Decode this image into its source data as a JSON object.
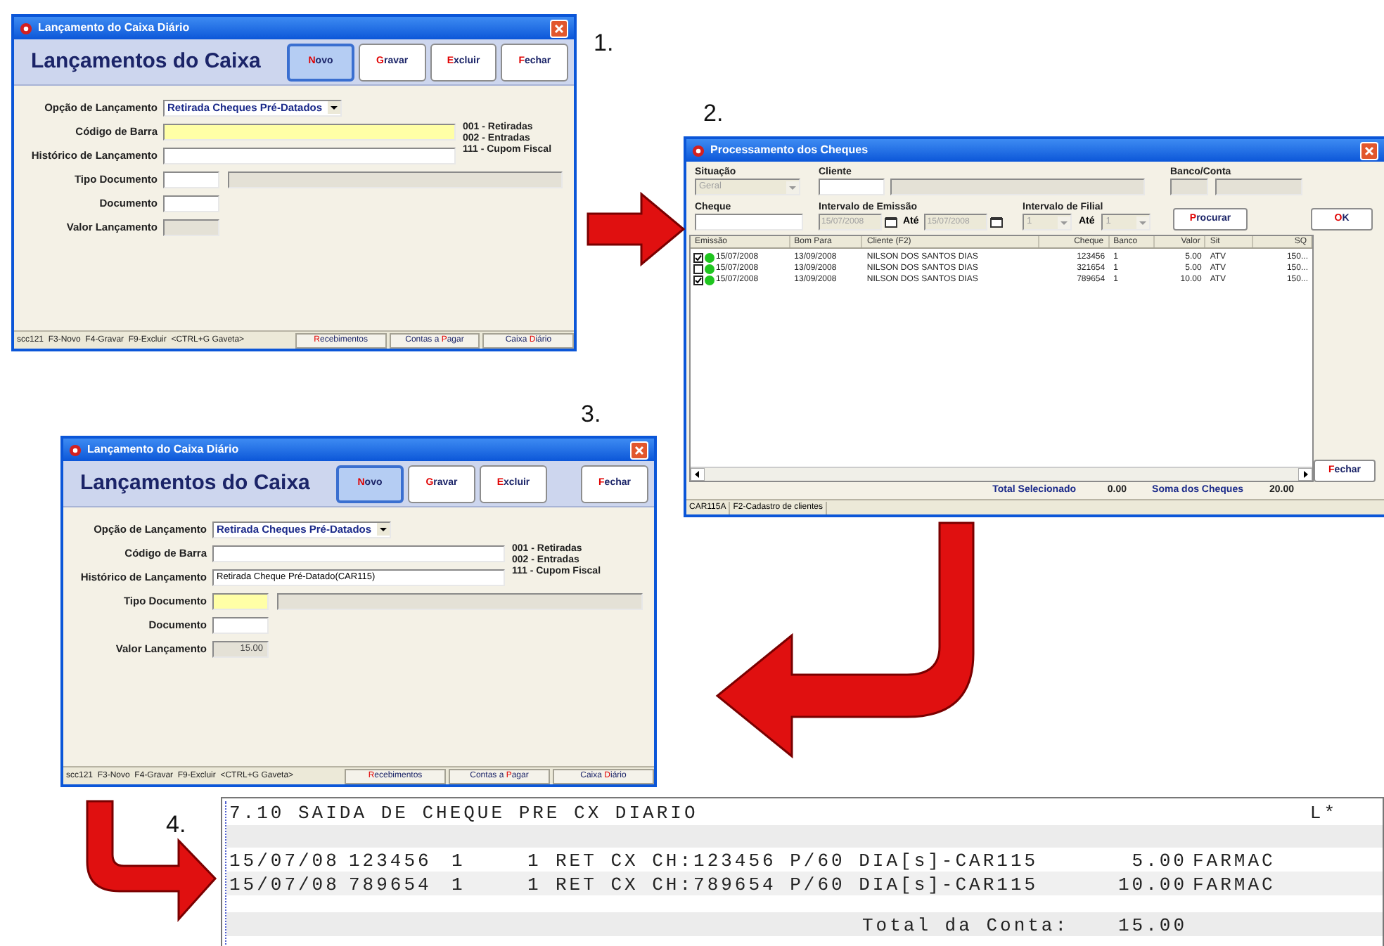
{
  "steps": [
    {
      "kind": "entry_form",
      "step": "1.",
      "title": "Lançamento do Caixa Diário",
      "heading": "Lançamentos do Caixa",
      "buttons": [
        {
          "hotkey": "N",
          "after": "ovo",
          "selected": true
        },
        {
          "hotkey": "G",
          "after": "ravar",
          "selected": false
        },
        {
          "hotkey": "E",
          "after": "xcluir",
          "selected": false
        },
        {
          "hotkey": "F",
          "after": "echar",
          "selected": false
        }
      ],
      "fields": [
        {
          "kind": "combo",
          "label": "Opção de Lançamento",
          "value": "Retirada Cheques Pré-Datados",
          "focused": false,
          "disabled": false
        },
        {
          "kind": "wide",
          "label": "Código de Barra",
          "focused": true,
          "disabled": false
        },
        {
          "kind": "wide",
          "label": "Histórico de Lançamento",
          "focused": false,
          "disabled": false
        },
        {
          "kind": "pair",
          "label": "Tipo Documento",
          "focused": false,
          "disabled": false
        },
        {
          "kind": "short",
          "label": "Documento",
          "focused": false,
          "disabled": false
        },
        {
          "kind": "short",
          "label": "Valor Lançamento",
          "focused": false,
          "disabled": true
        }
      ],
      "codes": [
        "001 - Retiradas",
        "002 - Entradas",
        "111 - Cupom Fiscal"
      ],
      "status": {
        "text": "scc121  F3-Novo  F4-Gravar  F9-Excluir  <CTRL+G Gaveta>",
        "tabs": [
          {
            "hotkey": "R",
            "after": "ecebimentos"
          },
          {
            "before": "Contas a ",
            "hotkey": "P",
            "after": "agar"
          },
          {
            "before": "Caixa ",
            "hotkey": "D",
            "after": "iário"
          }
        ]
      }
    },
    {
      "kind": "cheques",
      "step": "2.",
      "title": "Processamento dos Cheques",
      "situacao": {
        "label": "Situação",
        "value": "Geral",
        "disabled": true
      },
      "cliente": {
        "label": "Cliente"
      },
      "banco": {
        "label": "Banco/Conta"
      },
      "cheque": {
        "label": "Cheque"
      },
      "emissao": {
        "label": "Intervalo de Emissão",
        "from": "15/07/2008",
        "to_label": "Até",
        "to": "15/07/2008"
      },
      "filial": {
        "label": "Intervalo de Filial",
        "from": "1",
        "to_label": "Até",
        "to": "1"
      },
      "search_button": {
        "hotkey": "P",
        "after": "rocurar"
      },
      "ok_button": {
        "hotkey": "O",
        "after": "K"
      },
      "close_button": {
        "hotkey": "F",
        "after": "echar"
      },
      "table": {
        "columns": [
          "Emissão",
          "Bom Para",
          "Cliente (F2)",
          "Cheque",
          "Banco",
          "Valor",
          "Sit",
          "SQ"
        ],
        "rows": [
          {
            "checked": true,
            "color": "#1fc51f",
            "cells": [
              "15/07/2008",
              "13/09/2008",
              "NILSON DOS SANTOS DIAS",
              "123456",
              "1",
              "5.00",
              "ATV",
              "150..."
            ]
          },
          {
            "checked": false,
            "color": "#1fc51f",
            "cells": [
              "15/07/2008",
              "13/09/2008",
              "NILSON DOS SANTOS DIAS",
              "321654",
              "1",
              "5.00",
              "ATV",
              "150..."
            ]
          },
          {
            "checked": true,
            "color": "#1fc51f",
            "cells": [
              "15/07/2008",
              "13/09/2008",
              "NILSON DOS SANTOS DIAS",
              "789654",
              "1",
              "10.00",
              "ATV",
              "150..."
            ]
          }
        ]
      },
      "totals": [
        {
          "label": "Total Selecionado",
          "value": "0.00"
        },
        {
          "label": "Soma dos Cheques",
          "value": "20.00"
        }
      ],
      "status": [
        "CAR115A",
        "F2-Cadastro de clientes"
      ]
    },
    {
      "kind": "entry_form",
      "step": "3.",
      "title": "Lançamento do Caixa Diário",
      "heading": "Lançamentos do Caixa",
      "buttons": [
        {
          "hotkey": "N",
          "after": "ovo",
          "selected": true
        },
        {
          "hotkey": "G",
          "after": "ravar",
          "selected": false
        },
        {
          "hotkey": "E",
          "after": "xcluir",
          "selected": false
        },
        {
          "hotkey": "F",
          "after": "echar",
          "selected": false
        }
      ],
      "fields": [
        {
          "kind": "combo",
          "label": "Opção de Lançamento",
          "value": "Retirada Cheques Pré-Datados",
          "focused": false,
          "disabled": false
        },
        {
          "kind": "wide",
          "label": "Código de Barra",
          "focused": false,
          "disabled": false
        },
        {
          "kind": "wide",
          "label": "Histórico de Lançamento",
          "value": "Retirada Cheque Pré-Datado(CAR115)",
          "focused": false,
          "disabled": false
        },
        {
          "kind": "pair",
          "label": "Tipo Documento",
          "focused": true,
          "disabled": false
        },
        {
          "kind": "short",
          "label": "Documento",
          "focused": false,
          "disabled": false
        },
        {
          "kind": "short",
          "label": "Valor Lançamento",
          "value": "15.00",
          "focused": false,
          "disabled": true
        }
      ],
      "codes": [
        "001 - Retiradas",
        "002 - Entradas",
        "111 - Cupom Fiscal"
      ],
      "status": {
        "text": "scc121  F3-Novo  F4-Gravar  F9-Excluir  <CTRL+G Gaveta>",
        "tabs": [
          {
            "hotkey": "R",
            "after": "ecebimentos"
          },
          {
            "before": "Contas a ",
            "hotkey": "P",
            "after": "agar"
          },
          {
            "before": "Caixa ",
            "hotkey": "D",
            "after": "iário"
          }
        ]
      }
    },
    {
      "kind": "report",
      "step": "4.",
      "title": "7.10 SAIDA DE CHEQUE PRE CX DIARIO",
      "flag": "L*",
      "rows": [
        [
          "15/07/08",
          "123456",
          "1",
          "1",
          "RET CX CH:123456 P/60 DIA[s]-CAR115",
          "5.00",
          "FARMAC"
        ],
        [
          "15/07/08",
          "789654",
          "1",
          "1",
          "RET CX CH:789654 P/60 DIA[s]-CAR115",
          "10.00",
          "FARMAC"
        ]
      ],
      "total": {
        "label": "Total da Conta:",
        "value": "15.00"
      }
    }
  ]
}
